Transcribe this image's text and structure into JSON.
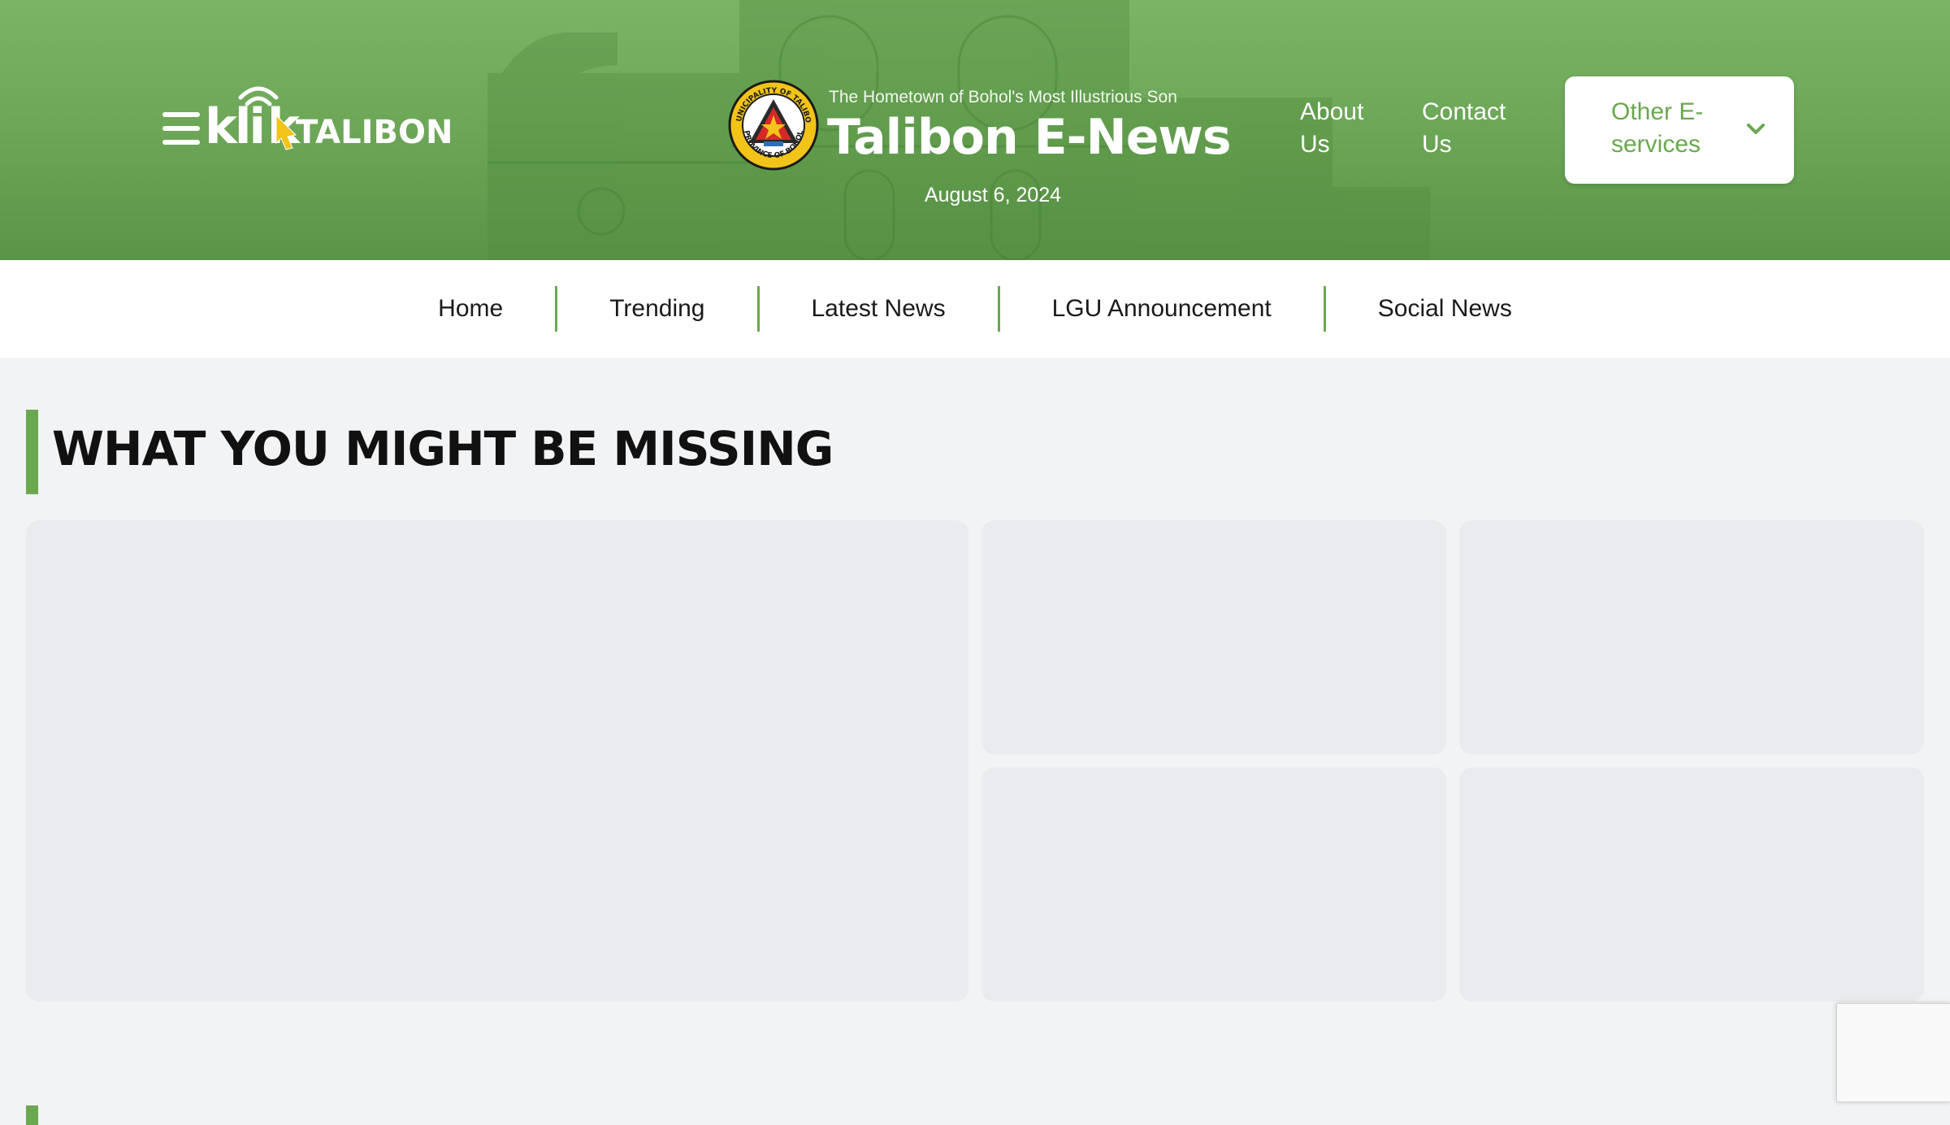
{
  "header": {
    "logo_text": "kliktalibon",
    "tagline": "The Hometown of Bohol's Most Illustrious Son",
    "site_title": "Talibon E-News",
    "date": "August 6, 2024",
    "seal_text_top": "MUNICIPALITY OF TALIBON",
    "seal_text_bottom": "PROVINCE OF BOHOL",
    "links": {
      "about": "About Us",
      "contact": "Contact Us"
    },
    "eservices_label": "Other E-services",
    "brand_color": "#6aa84f"
  },
  "nav": {
    "items": [
      "Home",
      "Trending",
      "Latest News",
      "LGU Announcement",
      "Social News"
    ]
  },
  "main": {
    "section_title": "WHAT YOU MIGHT BE MISSING"
  },
  "icons": {
    "menu": "hamburger-menu-icon",
    "dropdown": "chevron-down-icon"
  }
}
